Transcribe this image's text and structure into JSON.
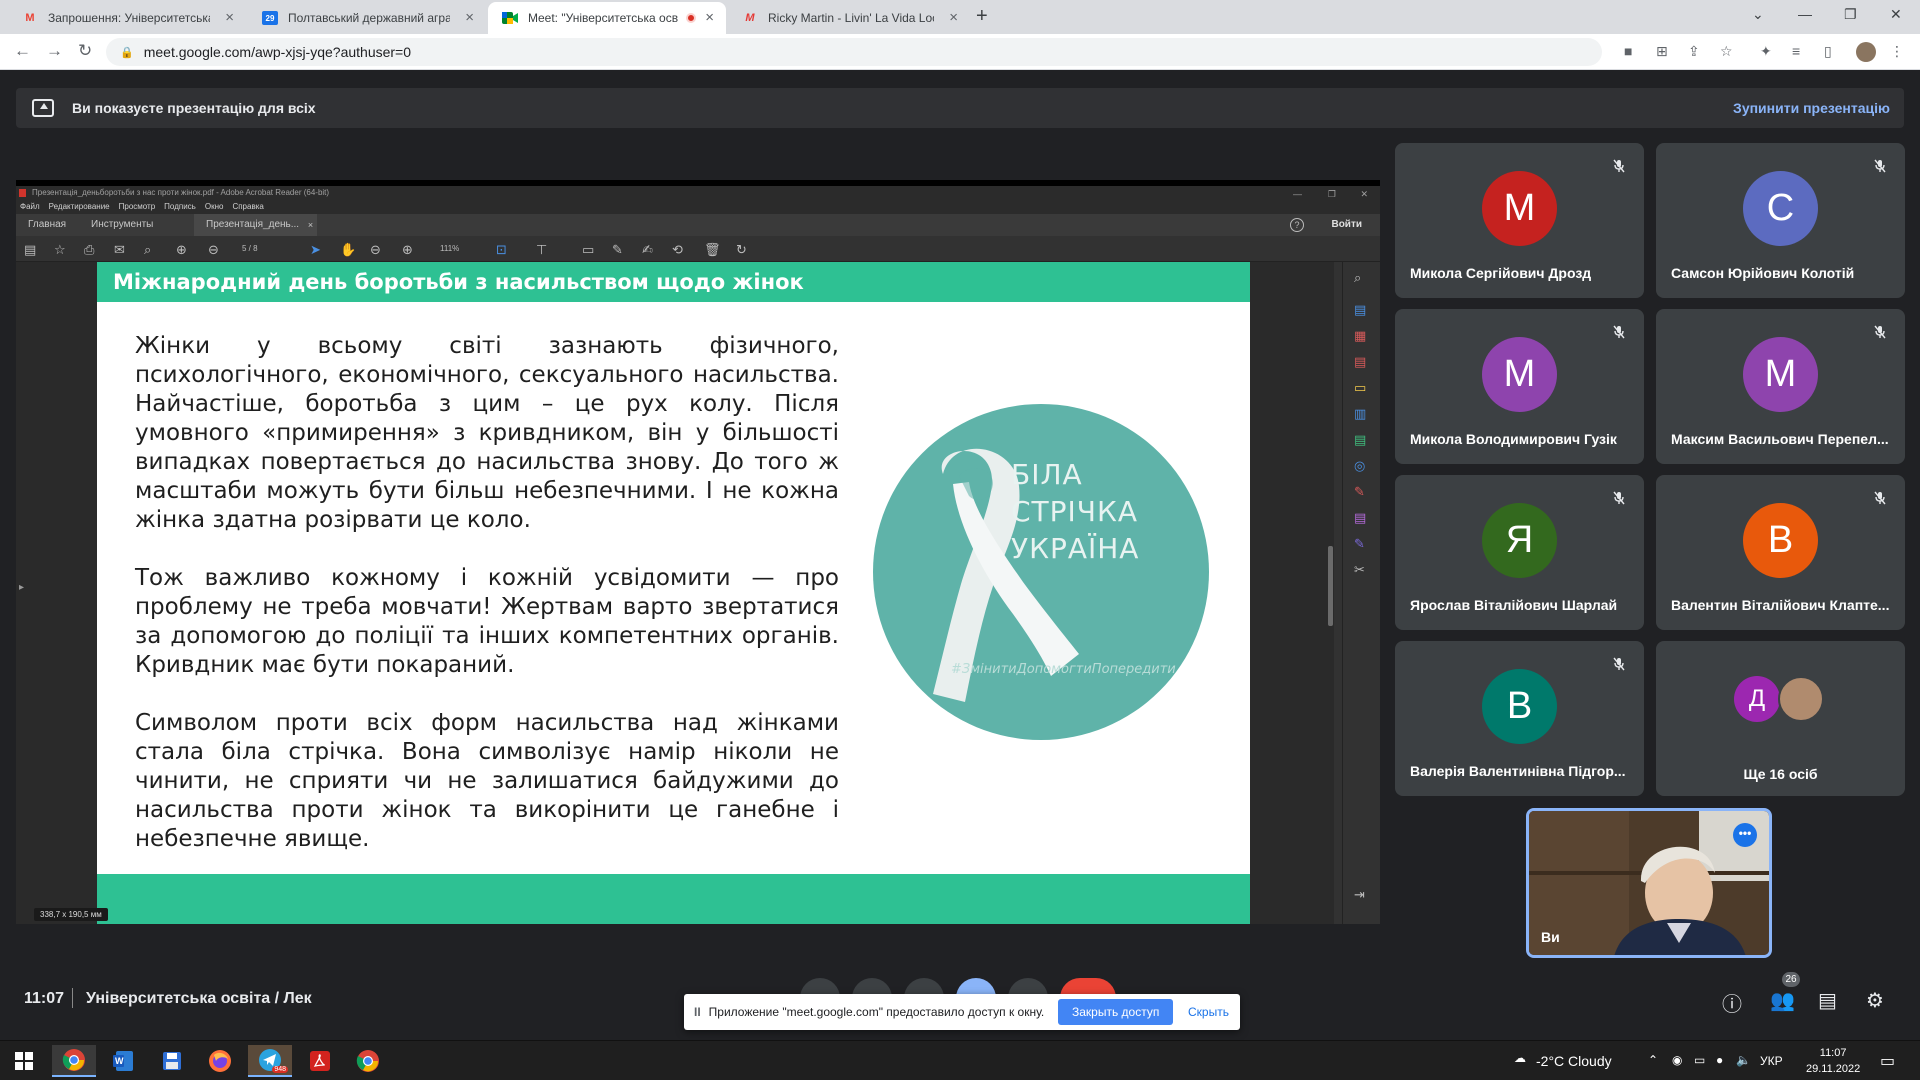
{
  "browser": {
    "tabs": [
      {
        "title": "Запрошення: Університетська о",
        "favicon": "gmail-icon",
        "active": false
      },
      {
        "title": "Полтавський державний аграр",
        "favicon": "calendar-icon",
        "active": false
      },
      {
        "title": "Meet: \"Університетська осв",
        "favicon": "meet-icon",
        "active": true,
        "recording": true
      },
      {
        "title": "Ricky Martin - Livin' La Vida Loca",
        "favicon": "music-icon",
        "active": false
      }
    ],
    "url": "meet.google.com/awp-xjsj-yqe?authuser=0"
  },
  "banner": {
    "text": "Ви показуєте презентацію для всіх",
    "stop_label": "Зупинити презентацію"
  },
  "acrobat": {
    "window_title": "Презентація_деньборотьби з нас проти жінок.pdf - Adobe Acrobat Reader (64-bit)",
    "menu": [
      "Файл",
      "Редактирование",
      "Просмотр",
      "Подпись",
      "Окно",
      "Справка"
    ],
    "tabs": {
      "home": "Главная",
      "tools": "Инструменты",
      "doc": "Презентація_день..."
    },
    "login": "Войти",
    "help": "?",
    "page": "5 / 8",
    "zoom": "111%",
    "size_badge": "338,7 x 190,5 мм"
  },
  "slide": {
    "title": "Міжнародний день боротьби з насильством щодо жінок",
    "paragraphs": [
      "Жінки у всьому світі зазнають фізичного, психологічного, економічного, сексуального насильства. Найчастіше, боротьба з цим – це рух колу. Після умовного «примирення» з кривдником, він у більшості випадках повертається до насильства знову. До того ж масштаби можуть бути більш небезпечними. І не кожна жінка здатна розірвати це коло.",
      "Тож важливо кожному і кожній усвідомити — про проблему не треба мовчати! Жертвам варто звертатися за допомогою до поліції та інших компетентних органів. Кривдник має бути покараний.",
      "Символом проти всіх форм насильства над жінками стала біла стрічка. Вона символізує намір ніколи не чинити, не сприяти чи не залишатися байдужими до насильства проти жінок та викорінити це ганебне і небезпечне явище."
    ],
    "logo_lines": [
      "БІЛА",
      "СТРІЧКА",
      "УКРАЇНА"
    ],
    "logo_tag": "#ЗмінитиДопомогтиПопередити"
  },
  "participants": [
    {
      "initial": "М",
      "name": "Микола Сергійович Дрозд",
      "color": "#c5221f"
    },
    {
      "initial": "С",
      "name": "Самсон Юрійович Колотій",
      "color": "#5c6bc0"
    },
    {
      "initial": "М",
      "name": "Микола Володимирович Гузік",
      "color": "#8e44ad"
    },
    {
      "initial": "М",
      "name": "Максим Васильович Перепел...",
      "color": "#8e44ad"
    },
    {
      "initial": "Я",
      "name": "Ярослав Віталійович Шарлай",
      "color": "#33691e"
    },
    {
      "initial": "В",
      "name": "Валентин Віталійович Клапте...",
      "color": "#e8590c"
    },
    {
      "initial": "В",
      "name": "Валерія Валентинівна Підгор...",
      "color": "#00796b"
    }
  ],
  "more": {
    "initial": "Д",
    "label": "Ще 16 осіб",
    "color": "#9c27b0"
  },
  "self": {
    "name": "Ви"
  },
  "meeting": {
    "time": "11:07",
    "name": "Університетська освіта / Лек",
    "participants_count": "26"
  },
  "sharebar": {
    "pause": "II",
    "text": "Приложение \"meet.google.com\" предоставило доступ к окну.",
    "stop": "Закрыть доступ",
    "hide": "Скрыть"
  },
  "taskbar": {
    "weather": "-2°C  Cloudy",
    "lang": "УКР",
    "time": "11:07",
    "date": "29.11.2022",
    "telegram_badge": "948"
  }
}
